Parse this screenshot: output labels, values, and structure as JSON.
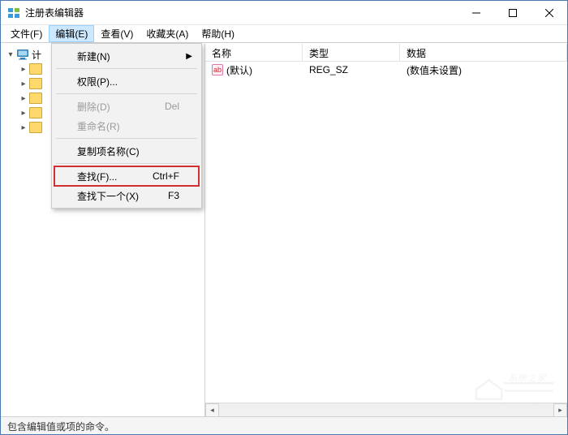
{
  "window": {
    "title": "注册表编辑器"
  },
  "menubar": {
    "file": "文件(F)",
    "edit": "编辑(E)",
    "view": "查看(V)",
    "favorites": "收藏夹(A)",
    "help": "帮助(H)"
  },
  "edit_menu": {
    "new": "新建(N)",
    "permissions": "权限(P)...",
    "delete": "删除(D)",
    "delete_shortcut": "Del",
    "rename": "重命名(R)",
    "copy_key_name": "复制项名称(C)",
    "find": "查找(F)...",
    "find_shortcut": "Ctrl+F",
    "find_next": "查找下一个(X)",
    "find_next_shortcut": "F3"
  },
  "tree": {
    "root": "计"
  },
  "list": {
    "headers": {
      "name": "名称",
      "type": "类型",
      "data": "数据"
    },
    "rows": [
      {
        "icon": "ab",
        "name": "(默认)",
        "type": "REG_SZ",
        "data": "(数值未设置)"
      }
    ]
  },
  "statusbar": {
    "text": "包含编辑值或项的命令。"
  },
  "watermark": {
    "line1": "系统之家",
    "line2": "XITONGZHIJIA.NET"
  }
}
